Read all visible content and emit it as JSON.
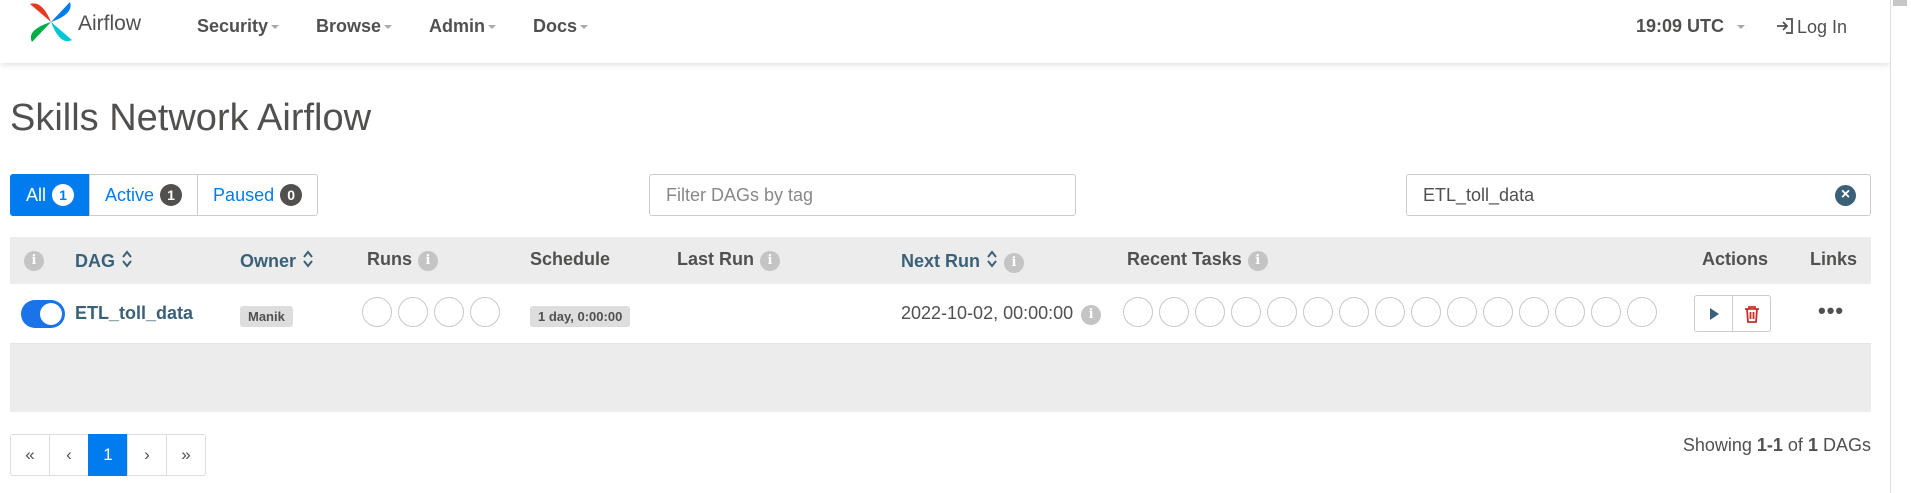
{
  "navbar": {
    "brand": "Airflow",
    "menu": [
      {
        "label": "Security"
      },
      {
        "label": "Browse"
      },
      {
        "label": "Admin"
      },
      {
        "label": "Docs"
      }
    ],
    "time": "19:09 UTC",
    "login": "Log In"
  },
  "page": {
    "title": "Skills Network Airflow"
  },
  "filters": {
    "all": {
      "label": "All",
      "count": "1"
    },
    "active": {
      "label": "Active",
      "count": "1"
    },
    "paused": {
      "label": "Paused",
      "count": "0"
    },
    "tag_placeholder": "Filter DAGs by tag",
    "search_value": "ETL_toll_data"
  },
  "table": {
    "headers": {
      "dag": "DAG",
      "owner": "Owner",
      "runs": "Runs",
      "schedule": "Schedule",
      "last_run": "Last Run",
      "next_run": "Next Run",
      "recent_tasks": "Recent Tasks",
      "actions": "Actions",
      "links": "Links"
    },
    "rows": [
      {
        "dag_id": "ETL_toll_data",
        "enabled": true,
        "owner": "Manik",
        "schedule": "1 day, 0:00:00",
        "last_run": "",
        "next_run": "2022-10-02, 00:00:00",
        "run_states": 4,
        "task_states": 15
      }
    ]
  },
  "pagination": {
    "first": "«",
    "prev": "‹",
    "current": "1",
    "next": "›",
    "last": "»"
  },
  "summary": {
    "prefix": "Showing",
    "range": "1-1",
    "of": "of",
    "total": "1",
    "suffix": "DAGs"
  },
  "colors": {
    "primary": "#017cee",
    "link": "#3b6178",
    "toggle": "#1a73e8",
    "delete": "#c9302c"
  }
}
